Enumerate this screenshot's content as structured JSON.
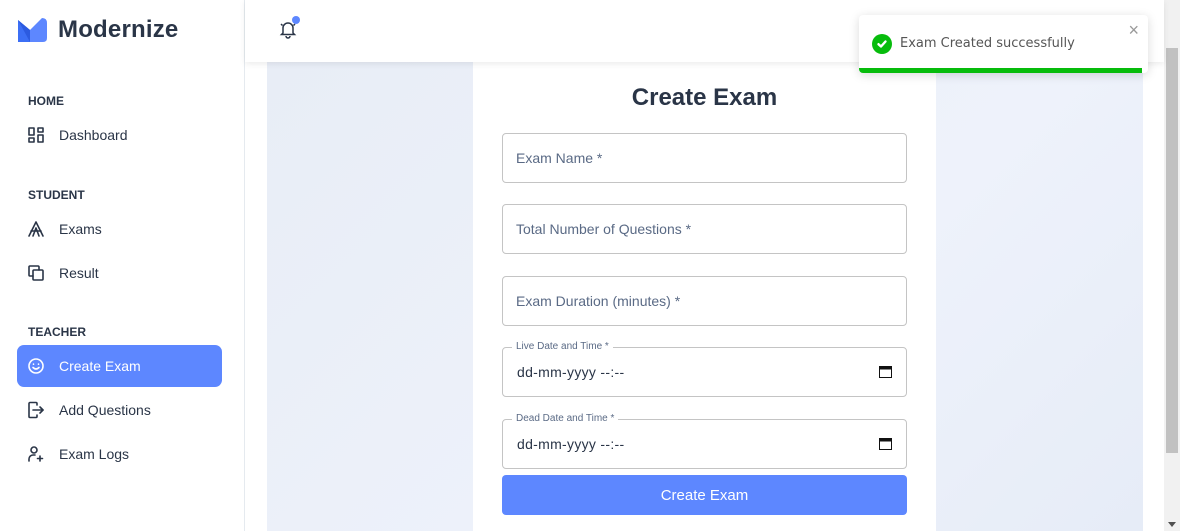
{
  "brand": {
    "name": "Modernize"
  },
  "sidebar": {
    "sections": [
      {
        "title": "HOME"
      },
      {
        "title": "STUDENT"
      },
      {
        "title": "TEACHER"
      }
    ],
    "items": [
      {
        "label": "Dashboard",
        "icon": "layout-dashboard-icon"
      },
      {
        "label": "Exams",
        "icon": "typography-icon"
      },
      {
        "label": "Result",
        "icon": "copy-icon"
      },
      {
        "label": "Create Exam",
        "icon": "mood-happy-icon",
        "active": true
      },
      {
        "label": "Add Questions",
        "icon": "login-icon"
      },
      {
        "label": "Exam Logs",
        "icon": "user-plus-icon"
      }
    ]
  },
  "header": {
    "notification_icon": "bell-icon"
  },
  "form": {
    "title": "Create Exam",
    "exam_name_placeholder": "Exam Name *",
    "total_questions_placeholder": "Total Number of Questions *",
    "duration_placeholder": "Exam Duration (minutes) *",
    "live_date_label": "Live Date and Time *",
    "live_date_value": "dd-mm-yyyy --:--",
    "dead_date_label": "Dead Date and Time *",
    "dead_date_value": "dd-mm-yyyy --:--",
    "submit_label": "Create Exam"
  },
  "toast": {
    "message": "Exam Created successfully",
    "close_symbol": "×",
    "progress_percent": 98
  },
  "colors": {
    "accent": "#5d87ff",
    "success": "#07bc0c",
    "text": "#2a3547"
  }
}
